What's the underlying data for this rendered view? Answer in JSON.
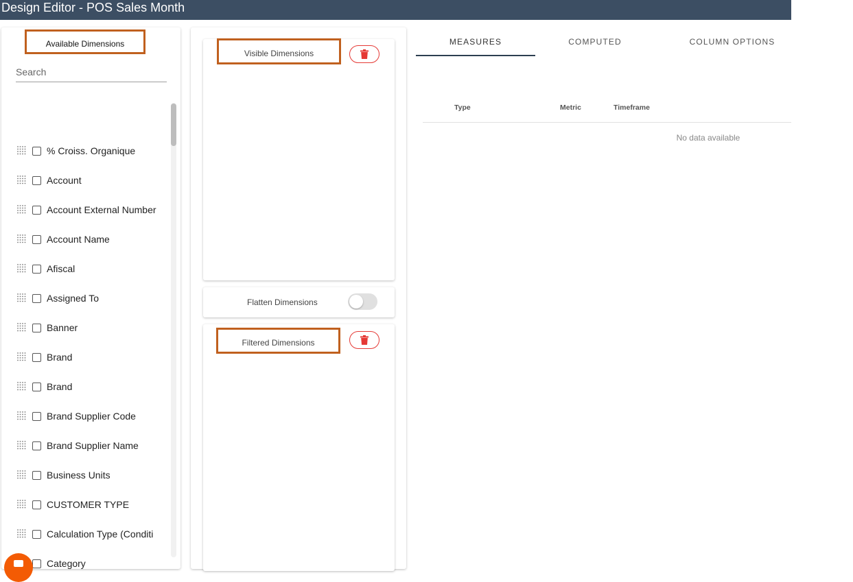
{
  "window": {
    "title": "Design Editor - POS Sales Month"
  },
  "available_dimensions": {
    "title": "Available Dimensions",
    "search_placeholder": "Search",
    "items": [
      "% Croiss. Organique",
      "Account",
      "Account External Number",
      "Account Name",
      "Afiscal",
      "Assigned To",
      "Banner",
      "Brand",
      "Brand",
      "Brand Supplier Code",
      "Brand Supplier Name",
      "Business Units",
      "CUSTOMER TYPE",
      "Calculation Type (Conditi",
      "Category"
    ]
  },
  "visible_dimensions": {
    "title": "Visible Dimensions"
  },
  "flatten": {
    "label": "Flatten Dimensions",
    "enabled": false
  },
  "filtered_dimensions": {
    "title": "Filtered Dimensions"
  },
  "tabs": [
    {
      "label": "MEASURES",
      "active": true
    },
    {
      "label": "COMPUTED",
      "active": false
    },
    {
      "label": "COLUMN OPTIONS",
      "active": false
    }
  ],
  "measures_table": {
    "columns": [
      "Type",
      "Metric",
      "Timeframe"
    ],
    "empty_text": "No data available"
  },
  "colors": {
    "header": "#3c4e63",
    "highlight": "#c0601e",
    "danger": "#e53935",
    "fab": "#f35b04"
  }
}
